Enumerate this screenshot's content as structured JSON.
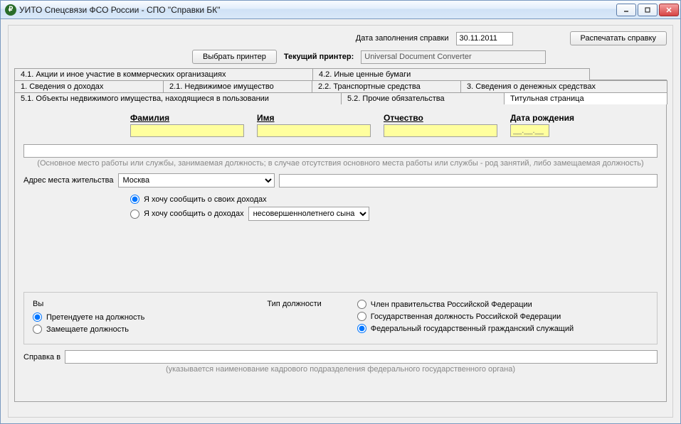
{
  "window": {
    "title": "УИТО Спецсвязи ФСО России - СПО \"Справки БК\""
  },
  "header": {
    "date_label": "Дата заполнения справки",
    "date_value": "30.11.2011",
    "print_button": "Распечатать справку",
    "choose_printer_button": "Выбрать принтер",
    "current_printer_label": "Текущий принтер:",
    "current_printer_value": "Universal Document Converter"
  },
  "tabs": {
    "row1": [
      "4.1. Акции и иное участие в коммерческих организациях",
      "4.2. Иные ценные бумаги"
    ],
    "row2": [
      "1. Сведения о доходах",
      "2.1. Недвижимое имущество",
      "2.2. Транспортные средства",
      "3. Сведения о денежных средствах"
    ],
    "row3": [
      "5.1. Объекты недвижимого имущества, находящиеся в пользовании",
      "5.2. Прочие обязательства",
      "Титульная страница"
    ]
  },
  "title_page": {
    "surname_label": "Фамилия",
    "name_label": "Имя",
    "patronymic_label": "Отчество",
    "dob_label": "Дата рождения",
    "dob_placeholder": "__.__.__",
    "job_hint": "(Основное место работы или службы, занимаемая должность; в случае отсутствия основного места работы или службы - род занятий, либо замещаемая должность)",
    "address_label": "Адрес места жительства",
    "address_value": "Москва",
    "radio_own": "Я хочу сообщить о своих доходах",
    "radio_other": "Я хочу сообщить о доходах",
    "other_select": "несовершеннолетнего сына",
    "group_you_title": "Вы",
    "group_you_opt1": "Претендуете на должность",
    "group_you_opt2": "Замещаете должность",
    "group_pos_title": "Тип должности",
    "group_pos_opt1": "Член правительства Российской Федерации",
    "group_pos_opt2": "Государственная должность Российской Федерации",
    "group_pos_opt3": "Федеральный государственный гражданский служащий",
    "spravka_label": "Справка в",
    "spravka_hint": "(указывается наименование кадрового подразделения федерального государственного органа)"
  }
}
